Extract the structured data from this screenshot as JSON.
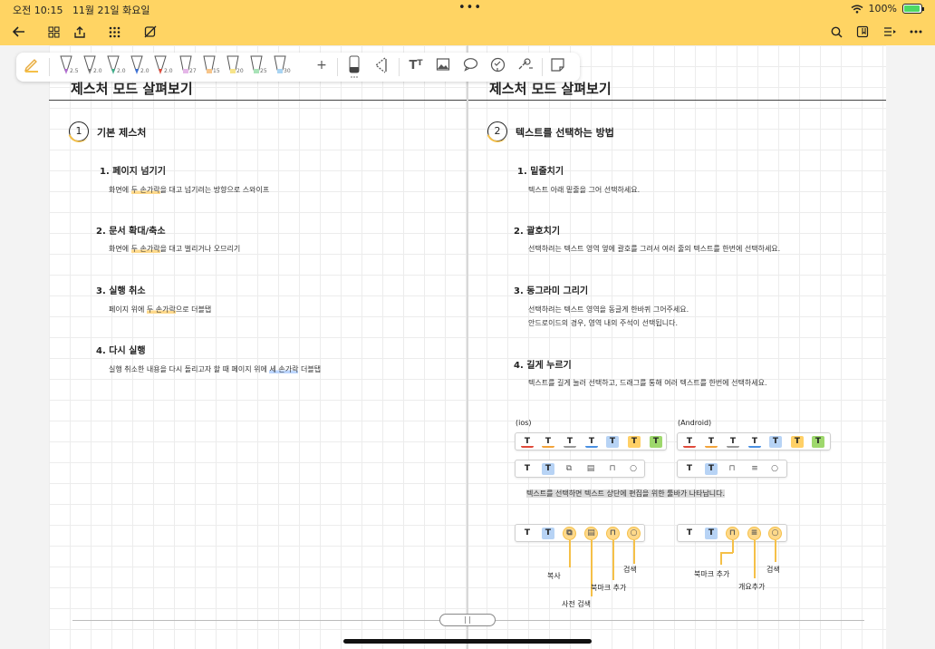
{
  "status": {
    "time": "오전 10:15",
    "date": "11월 21일 화요일",
    "battery": "100%",
    "dots": "•••"
  },
  "topbar": {
    "left_icons": [
      "back-arrow-icon",
      "grid-view-icon",
      "share-icon",
      "apps-icon",
      "edit-off-icon"
    ],
    "right_icons": [
      "search-icon",
      "bookmark-icon",
      "outline-icon",
      "more-icon"
    ]
  },
  "toolbar": {
    "pens": [
      {
        "size": "2.5",
        "color": "#b06ad1"
      },
      {
        "size": "2.0",
        "color": "#777777"
      },
      {
        "size": "2.0",
        "color": "#3fae8a"
      },
      {
        "size": "2.0",
        "color": "#3a6fd8"
      },
      {
        "size": "2.0",
        "color": "#e04a3a"
      }
    ],
    "highlighters": [
      {
        "size": "27",
        "color": "#e5b7e8"
      },
      {
        "size": "15",
        "color": "#f7c58a"
      },
      {
        "size": "20",
        "color": "#f7e48a"
      },
      {
        "size": "25",
        "color": "#a9e3b8"
      },
      {
        "size": "30",
        "color": "#a9d4f2"
      }
    ],
    "add": "+"
  },
  "left_page": {
    "title": "제스처 모드 살펴보기",
    "section_num": "1",
    "section_title": "기본 제스처",
    "items": [
      {
        "h": "1. 페이지 넘기기",
        "d_pre": "화면에 ",
        "d_hl": "두 손가락",
        "d_post": "을 대고 넘기려는 방향으로 스와이프"
      },
      {
        "h": "2. 문서 확대/축소",
        "d_pre": "화면에 ",
        "d_hl": "두 손가락",
        "d_post": "을 대고 벌리거나 오므리기"
      },
      {
        "h": "3. 실행 취소",
        "d_pre": "페이지 위에 ",
        "d_hl": "두 손가락",
        "d_post": "으로 더블탭"
      },
      {
        "h": "4. 다시 실행",
        "d_pre": "실행 취소한 내용을 다시 돌리고자 할 때 페이지 위에 ",
        "d_hl": "세 손가락",
        "d_post": " 더블탭"
      }
    ]
  },
  "right_page": {
    "title": "제스처 모드 살펴보기",
    "section_num": "2",
    "section_title": "텍스트를 선택하는 방법",
    "items": [
      {
        "h": "1. 밑줄치기",
        "d": "텍스트 아래 밑줄을 그어 선택하세요."
      },
      {
        "h": "2. 괄호치기",
        "d": "선택하려는 텍스트 영역 옆에 괄호를 그려서 여러 줄의 텍스트를 한번에 선택하세요."
      },
      {
        "h": "3. 동그라미 그리기",
        "d": "선택하려는 텍스트 영역을 동글게 한바퀴 그어주세요.",
        "d2": "안드로이드의 경우, 영역 내의 주석이 선택됩니다."
      },
      {
        "h": "4. 길게 누르기",
        "d": "텍스트를 길게 눌러 선택하고, 드래그를 통해 여러 텍스트를 한번에 선택하세요."
      }
    ],
    "ios_label": "(ios)",
    "android_label": "(Android)",
    "popup_note": "텍스트를 선택하면 텍스트 상단에 편집을 위한 툴바가 나타납니다.",
    "callouts": {
      "copy": "복사",
      "dict": "사전 검색",
      "bookmark": "북마크 추가",
      "search_ios": "검색",
      "bookmark_android": "북마크 추가",
      "outline": "개요추가",
      "search_android": "검색"
    }
  },
  "t_glyph": "T",
  "handle_label": "| |"
}
